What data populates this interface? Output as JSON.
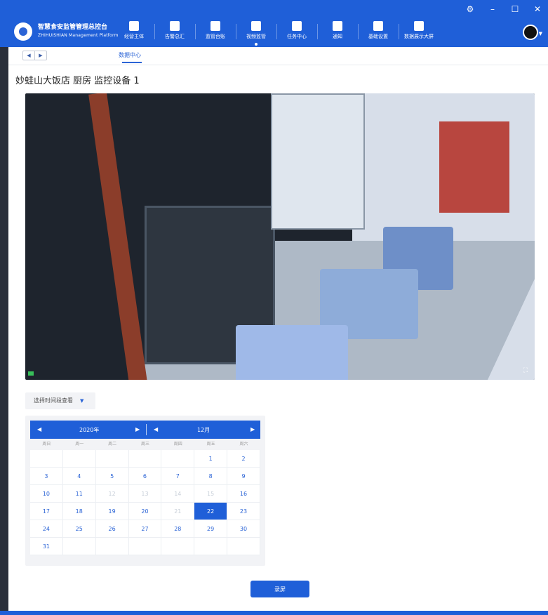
{
  "window_controls": [
    "⚙",
    "–",
    "☐",
    "✕"
  ],
  "brand": {
    "name": "智慧食安监管管理总控台",
    "name_en": "ZHIHUISHIAN Management Platform"
  },
  "nav": [
    {
      "label": "经营主体",
      "icon": "building-icon"
    },
    {
      "label": "告警总汇",
      "icon": "alarm-icon"
    },
    {
      "label": "监管台账",
      "icon": "ledger-icon"
    },
    {
      "label": "视频监管",
      "icon": "video-flag-icon",
      "active": true
    },
    {
      "label": "任务中心",
      "icon": "clipboard-icon"
    },
    {
      "label": "通知",
      "icon": "chat-icon"
    },
    {
      "label": "基础设置",
      "icon": "gear-icon"
    },
    {
      "label": "数据展示大屏",
      "icon": "screen-icon"
    }
  ],
  "tabs": {
    "back": "◀",
    "forward": "▶",
    "current": "数据中心"
  },
  "page_title": "妙蛙山大饭店 厨房 监控设备 1",
  "video": {
    "fullscreen_glyph": "⛶"
  },
  "time_select": {
    "label": "选择时间段查看",
    "caret": "▼"
  },
  "calendar": {
    "prev_year": "◀",
    "year": "2020年",
    "next_year": "▶",
    "prev_month": "◀",
    "month": "12月",
    "next_month": "▶",
    "weekdays": [
      "周日",
      "周一",
      "周二",
      "周三",
      "周四",
      "周五",
      "周六"
    ],
    "selected_day": "22",
    "disabled_days": [
      "12",
      "13",
      "14",
      "15",
      "21"
    ]
  },
  "record_button": "录屏"
}
